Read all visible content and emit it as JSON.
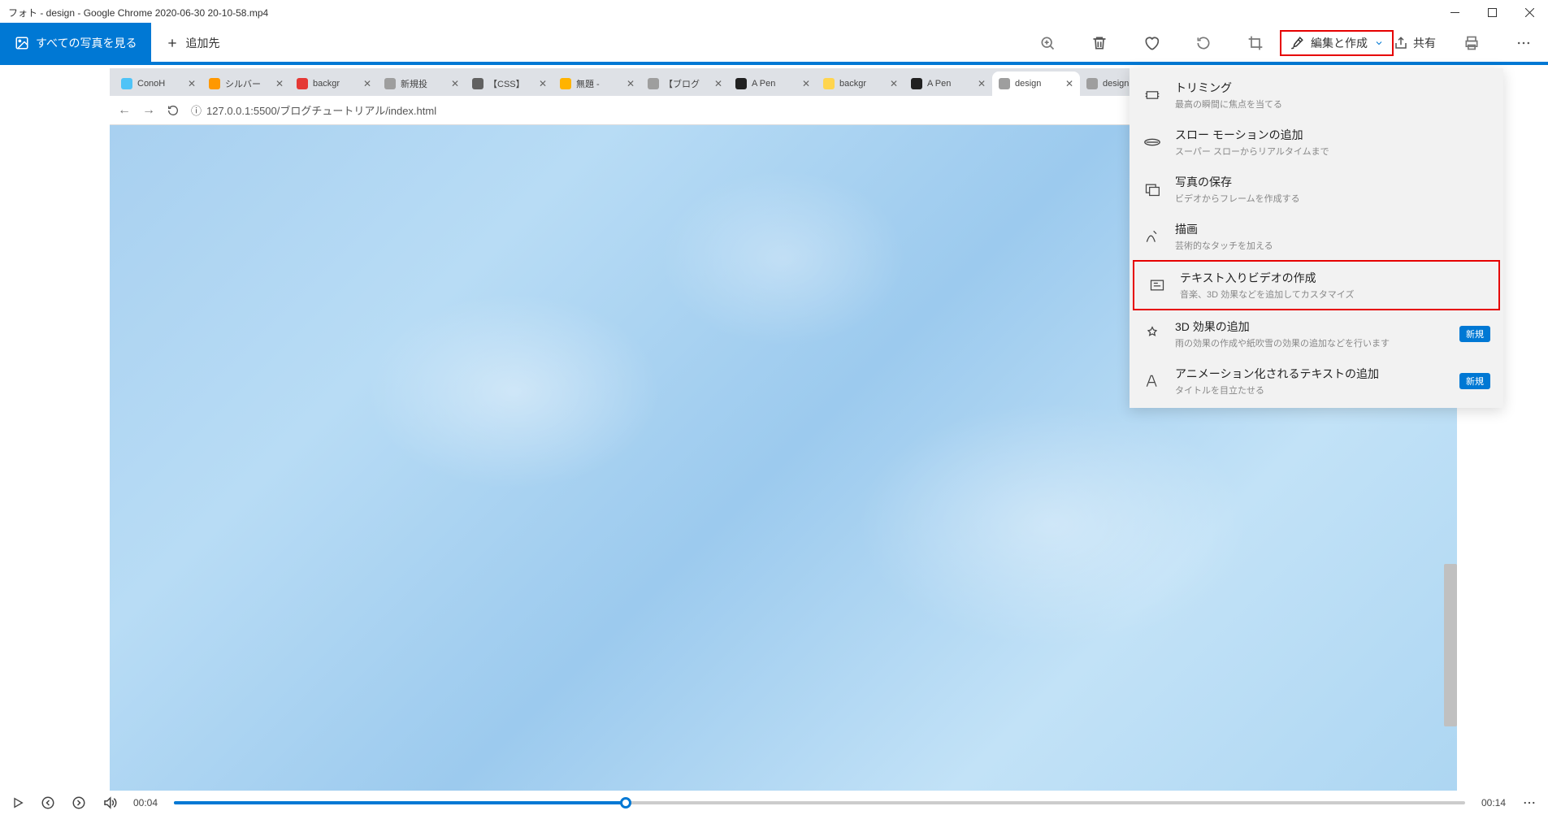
{
  "titlebar": {
    "title": "フォト - design - Google Chrome 2020-06-30 20-10-58.mp4"
  },
  "toolbar": {
    "all_photos": "すべての写真を見る",
    "add_destination": "追加先",
    "edit_create": "編集と作成",
    "share": "共有"
  },
  "chrome": {
    "tabs": [
      {
        "label": "ConoH",
        "color": "#4fc3f7"
      },
      {
        "label": "シルバー",
        "color": "#ff9800"
      },
      {
        "label": "backgr",
        "color": "#e53935"
      },
      {
        "label": "新規投",
        "color": "#9e9e9e"
      },
      {
        "label": "【CSS】",
        "color": "#616161"
      },
      {
        "label": "無題 -",
        "color": "#ffb300"
      },
      {
        "label": "【ブログ",
        "color": "#9e9e9e"
      },
      {
        "label": "A Pen",
        "color": "#212121"
      },
      {
        "label": "backgr",
        "color": "#ffd54f"
      },
      {
        "label": "A Pen",
        "color": "#212121"
      },
      {
        "label": "design",
        "color": "#9e9e9e"
      },
      {
        "label": "design",
        "color": "#9e9e9e"
      }
    ],
    "url": "127.0.0.1:5500/ブログチュートリアル/index.html"
  },
  "menu": {
    "items": [
      {
        "title": "トリミング",
        "desc": "最高の瞬間に焦点を当てる"
      },
      {
        "title": "スロー モーションの追加",
        "desc": "スーパー スローからリアルタイムまで"
      },
      {
        "title": "写真の保存",
        "desc": "ビデオからフレームを作成する"
      },
      {
        "title": "描画",
        "desc": "芸術的なタッチを加える"
      },
      {
        "title": "テキスト入りビデオの作成",
        "desc": "音楽、3D 効果などを追加してカスタマイズ"
      },
      {
        "title": "3D 効果の追加",
        "desc": "雨の効果の作成や紙吹雪の効果の追加などを行います",
        "badge": "新規"
      },
      {
        "title": "アニメーション化されるテキストの追加",
        "desc": "タイトルを目立たせる",
        "badge": "新規"
      }
    ]
  },
  "video": {
    "current": "00:04",
    "total": "00:14"
  }
}
